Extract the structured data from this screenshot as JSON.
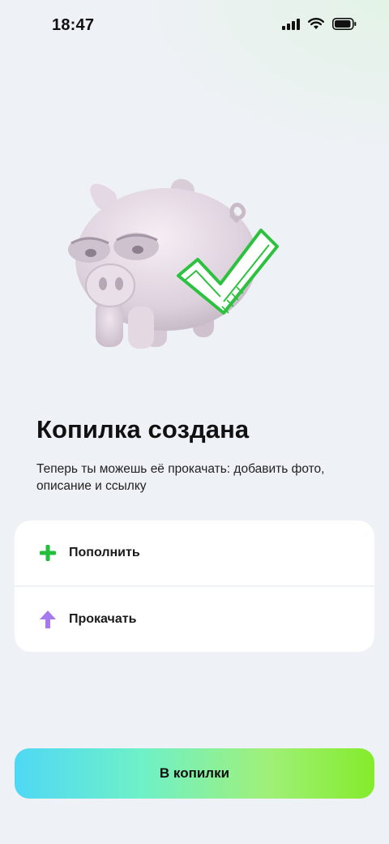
{
  "status_bar": {
    "time": "18:47",
    "icons": [
      "signal-icon",
      "wifi-icon",
      "battery-icon"
    ]
  },
  "hero": {
    "icon": "piggy-bank-with-checkmark"
  },
  "title": "Копилка создана",
  "subtitle": "Теперь ты можешь её прокачать: добавить фото, описание и ссылку",
  "actions": [
    {
      "label": "Пополнить",
      "icon": "plus-icon",
      "icon_color": "#22c03a"
    },
    {
      "label": "Прокачать",
      "icon": "arrow-up-icon",
      "icon_color": "#a779ee"
    }
  ],
  "primary_button": {
    "label": "В копилки"
  },
  "colors": {
    "background": "#eef1f5",
    "card": "#ffffff",
    "button_gradient": [
      "#4fd8f5",
      "#6ef0c8",
      "#9ff07a",
      "#84ec2a"
    ]
  }
}
